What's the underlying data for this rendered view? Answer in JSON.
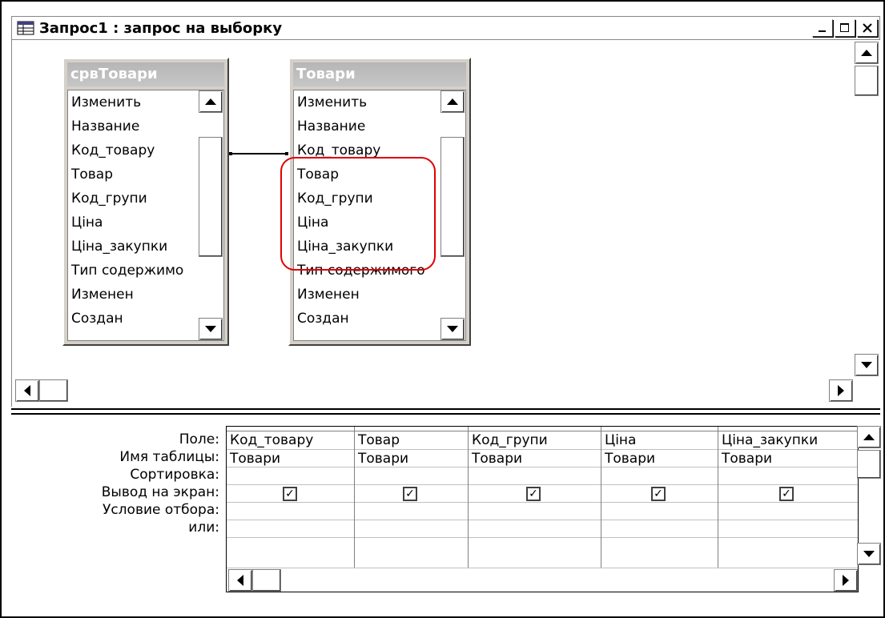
{
  "window": {
    "title": "Запрос1 : запрос на выборку"
  },
  "tables": [
    {
      "name": "срвТовари",
      "fields": [
        "Изменить",
        "Название",
        "Код_товару",
        "Товар",
        "Код_групи",
        "Ціна",
        "Ціна_закупки",
        "Тип содержимо",
        "Изменен",
        "Создан"
      ]
    },
    {
      "name": "Товари",
      "fields": [
        "Изменить",
        "Название",
        "Код_товару",
        "Товар",
        "Код_групи",
        "Ціна",
        "Ціна_закупки",
        "Тип содержимого",
        "Изменен",
        "Создан"
      ]
    }
  ],
  "grid": {
    "row_labels": [
      "Поле:",
      "Имя таблицы:",
      "Сортировка:",
      "Вывод на экран:",
      "Условие отбора:",
      "или:"
    ],
    "columns": [
      {
        "field": "Код_товару",
        "table": "Товари",
        "show": true
      },
      {
        "field": "Товар",
        "table": "Товари",
        "show": true
      },
      {
        "field": "Код_групи",
        "table": "Товари",
        "show": true
      },
      {
        "field": "Ціна",
        "table": "Товари",
        "show": true
      },
      {
        "field": "Ціна_закупки",
        "table": "Товари",
        "show": true
      }
    ]
  },
  "colors": {
    "highlight": "#e00000",
    "header": "#c0c0c0"
  }
}
